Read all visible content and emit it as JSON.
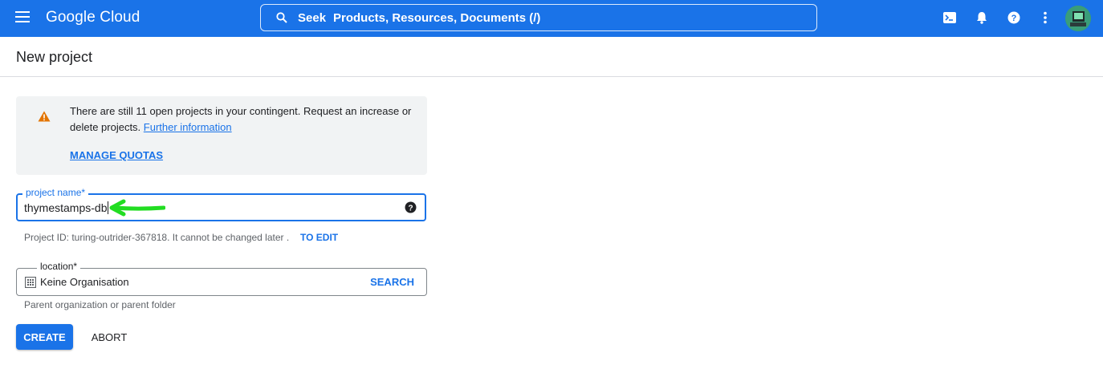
{
  "topbar": {
    "brand": "Google Cloud",
    "search": {
      "label": "Seek",
      "hint": "Products, Resources, Documents (/)"
    },
    "icons": [
      "menu-icon",
      "search-icon",
      "cloud-shell-icon",
      "notifications-icon",
      "help-icon",
      "more-vert-icon",
      "avatar"
    ],
    "color": "#1a73e8"
  },
  "page": {
    "title": "New project"
  },
  "warning": {
    "text": "There are still 11 open projects in your contingent. Request an increase or delete projects.",
    "link": "Further information",
    "action": "MANAGE QUOTAS",
    "icon": "warning-icon",
    "icon_color": "#e37400"
  },
  "project_name": {
    "label": "project name*",
    "value": "thymestamps-db",
    "id_text": "Project ID: turing-outrider-367818. It cannot be changed later .",
    "edit_label": "TO EDIT"
  },
  "location": {
    "label": "location*",
    "value": "Keine Organisation",
    "search_label": "SEARCH",
    "hint": "Parent organization or parent folder"
  },
  "actions": {
    "create": "CREATE",
    "abort": "ABORT"
  },
  "annotation": {
    "arrow_color": "#22dd22"
  }
}
